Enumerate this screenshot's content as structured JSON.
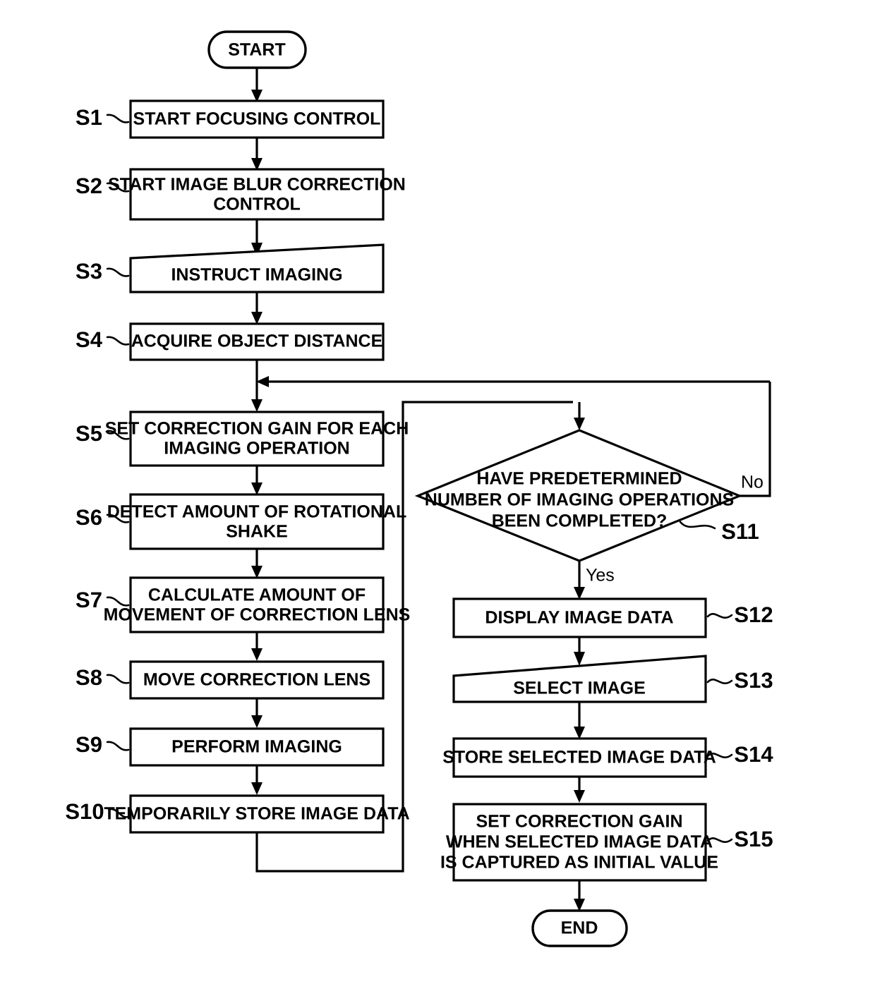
{
  "diagram": {
    "type": "flowchart",
    "title": "",
    "orientation": "two-column",
    "terminators": {
      "start": "START",
      "end": "END"
    },
    "branch_labels": {
      "no": "No",
      "yes": "Yes"
    },
    "steps": [
      {
        "id": "S1",
        "label": "S1",
        "shape": "process",
        "lines": [
          "START FOCUSING CONTROL"
        ]
      },
      {
        "id": "S2",
        "label": "S2",
        "shape": "process",
        "lines": [
          "START IMAGE BLUR CORRECTION",
          "CONTROL"
        ]
      },
      {
        "id": "S3",
        "label": "S3",
        "shape": "manual-input",
        "lines": [
          "INSTRUCT IMAGING"
        ]
      },
      {
        "id": "S4",
        "label": "S4",
        "shape": "process",
        "lines": [
          "ACQUIRE OBJECT DISTANCE"
        ]
      },
      {
        "id": "S5",
        "label": "S5",
        "shape": "process",
        "lines": [
          "SET CORRECTION GAIN FOR EACH",
          "IMAGING OPERATION"
        ]
      },
      {
        "id": "S6",
        "label": "S6",
        "shape": "process",
        "lines": [
          "DETECT AMOUNT OF ROTATIONAL",
          "SHAKE"
        ]
      },
      {
        "id": "S7",
        "label": "S7",
        "shape": "process",
        "lines": [
          "CALCULATE AMOUNT OF",
          "MOVEMENT OF CORRECTION LENS"
        ]
      },
      {
        "id": "S8",
        "label": "S8",
        "shape": "process",
        "lines": [
          "MOVE CORRECTION LENS"
        ]
      },
      {
        "id": "S9",
        "label": "S9",
        "shape": "process",
        "lines": [
          "PERFORM IMAGING"
        ]
      },
      {
        "id": "S10",
        "label": "S10",
        "shape": "process",
        "lines": [
          "TEMPORARILY STORE IMAGE DATA"
        ]
      },
      {
        "id": "S11",
        "label": "S11",
        "shape": "decision",
        "lines": [
          "HAVE PREDETERMINED",
          "NUMBER OF IMAGING OPERATIONS",
          "BEEN COMPLETED?"
        ]
      },
      {
        "id": "S12",
        "label": "S12",
        "shape": "process",
        "lines": [
          "DISPLAY IMAGE DATA"
        ]
      },
      {
        "id": "S13",
        "label": "S13",
        "shape": "manual-input",
        "lines": [
          "SELECT IMAGE"
        ]
      },
      {
        "id": "S14",
        "label": "S14",
        "shape": "process",
        "lines": [
          "STORE SELECTED IMAGE DATA"
        ]
      },
      {
        "id": "S15",
        "label": "S15",
        "shape": "process",
        "lines": [
          "SET CORRECTION GAIN",
          "WHEN SELECTED IMAGE DATA",
          "IS CAPTURED AS INITIAL VALUE"
        ]
      }
    ],
    "colors": {
      "stroke": "#000000",
      "fill": "#ffffff",
      "background": "#ffffff"
    }
  }
}
